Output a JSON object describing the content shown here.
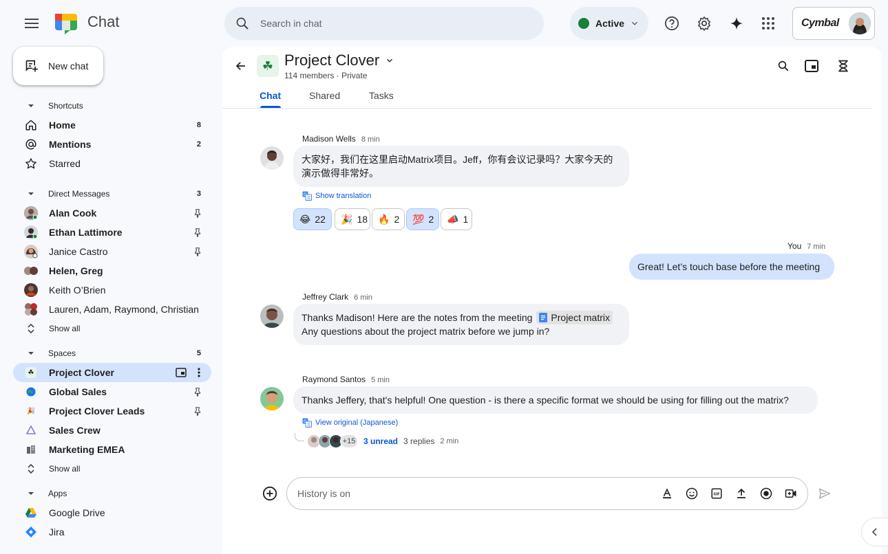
{
  "topbar": {
    "app_name": "Chat",
    "search_placeholder": "Search in chat",
    "status_label": "Active",
    "status_color": "#188038",
    "brand_name": "Cymbal",
    "icons": [
      "menu-icon",
      "help-icon",
      "gear-icon",
      "gemini-sparkle-icon",
      "apps-grid-icon"
    ]
  },
  "sidebar": {
    "new_chat_label": "New chat",
    "shortcuts_label": "Shortcuts",
    "shortcuts": [
      {
        "label": "Home",
        "count": "8",
        "icon": "home-icon",
        "bold": true
      },
      {
        "label": "Mentions",
        "count": "2",
        "icon": "at-icon",
        "bold": true
      },
      {
        "label": "Starred",
        "count": "",
        "icon": "star-icon",
        "bold": false
      }
    ],
    "dm_label": "Direct Messages",
    "dm_count": "3",
    "dms": [
      {
        "label": "Alan Cook",
        "bold": true,
        "pinned": true
      },
      {
        "label": "Ethan Lattimore",
        "bold": true,
        "pinned": true
      },
      {
        "label": "Janice Castro",
        "bold": false,
        "pinned": true
      },
      {
        "label": "Helen, Greg",
        "bold": true,
        "pinned": false
      },
      {
        "label": "Keith O’Brien",
        "bold": false,
        "pinned": false
      },
      {
        "label": "Lauren, Adam, Raymond, Christian",
        "bold": false,
        "pinned": false
      }
    ],
    "show_all_label": "Show all",
    "spaces_label": "Spaces",
    "spaces_count": "5",
    "spaces": [
      {
        "label": "Project Clover",
        "active": true
      },
      {
        "label": "Global Sales",
        "pinned": true
      },
      {
        "label": "Project Clover Leads",
        "pinned": true
      },
      {
        "label": "Sales Crew"
      },
      {
        "label": "Marketing EMEA"
      }
    ],
    "apps_label": "Apps",
    "apps": [
      {
        "label": "Google Drive",
        "icon": "google-drive-icon"
      },
      {
        "label": "Jira",
        "icon": "jira-icon"
      }
    ]
  },
  "space": {
    "name": "Project Clover",
    "meta": "114 members · Private",
    "tabs": [
      "Chat",
      "Shared",
      "Tasks"
    ],
    "active_tab": "Chat"
  },
  "messages": [
    {
      "sender": "Madison Wells",
      "time": "8 min",
      "text_line1": "大家好，我们在这里启动Matrix项目。Jeff，你有会议记录吗？大家今天的",
      "text_line2": "演示做得非常好。",
      "translate_label": "Show translation",
      "reactions": [
        {
          "emoji": "😂",
          "count": "22",
          "mine": true
        },
        {
          "emoji": "🎉",
          "count": "18",
          "mine": false
        },
        {
          "emoji": "🔥",
          "count": "2",
          "mine": false
        },
        {
          "emoji": "💯",
          "count": "2",
          "mine": true
        },
        {
          "emoji": "📣",
          "count": "1",
          "mine": false
        }
      ]
    },
    {
      "sender": "You",
      "time": "7 min",
      "text": "Great! Let’s touch base before the meeting"
    },
    {
      "sender": "Jeffrey Clark",
      "time": "6 min",
      "text_line1": "Thanks Madison!  Here are the notes from the meeting",
      "chip_label": "Project matrix",
      "text_line2": "Any questions about the project matrix before we jump in?"
    },
    {
      "sender": "Raymond Santos",
      "time": "5 min",
      "text": "Thanks Jeffery, that's helpful!  One question -  is there a specific format we should be using for filling out the matrix?",
      "original_label": "View original (Japanese)",
      "thread_extra": "+15",
      "thread_unread": "3 unread",
      "thread_replies": "3 replies",
      "thread_time": "2 min"
    }
  ],
  "composer": {
    "placeholder": "History is on"
  }
}
